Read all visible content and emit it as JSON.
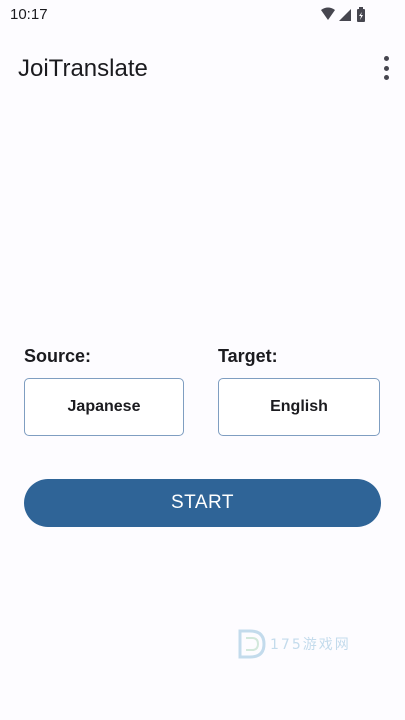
{
  "status_bar": {
    "time": "10:17",
    "icons": [
      "wifi-icon",
      "signal-icon",
      "battery-icon"
    ]
  },
  "app_bar": {
    "title": "JoiTranslate",
    "menu_icon": "more-vert-icon"
  },
  "languages": {
    "source_label": "Source:",
    "source_value": "Japanese",
    "target_label": "Target:",
    "target_value": "English"
  },
  "actions": {
    "start_label": "START"
  },
  "watermark": {
    "text": "175游戏网"
  },
  "colors": {
    "accent": "#2f6497",
    "box_border": "#7f9ec1",
    "background": "#fdfcff"
  }
}
